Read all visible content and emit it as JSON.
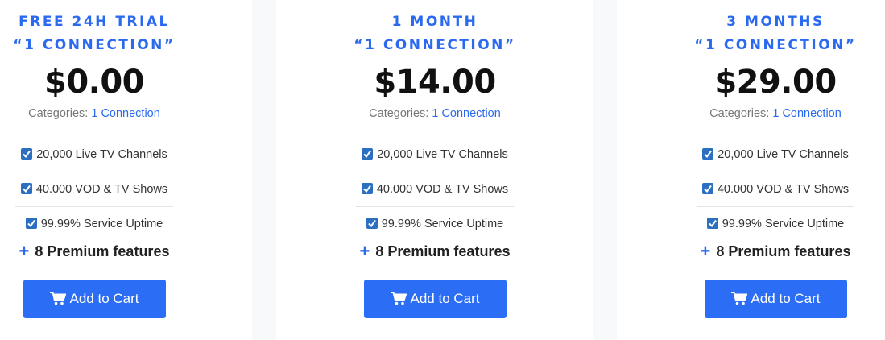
{
  "plans": [
    {
      "title_line1": "FREE 24H TRIAL",
      "title_line2": "“1 CONNECTION”",
      "price": "$0.00",
      "categories_label": "Categories:",
      "categories_link": "1 Connection",
      "features": [
        "20,000 Live TV Channels",
        "40.000 VOD & TV Shows",
        "99.99% Service Uptime"
      ],
      "premium": "8 Premium features",
      "button": "Add to Cart"
    },
    {
      "title_line1": "1 MONTH",
      "title_line2": "“1 CONNECTION”",
      "price": "$14.00",
      "categories_label": "Categories:",
      "categories_link": "1 Connection",
      "features": [
        "20,000 Live TV Channels",
        "40.000 VOD & TV Shows",
        "99.99% Service Uptime"
      ],
      "premium": "8 Premium features",
      "button": "Add to Cart"
    },
    {
      "title_line1": "3 MONTHS",
      "title_line2": "“1 CONNECTION”",
      "price": "$29.00",
      "categories_label": "Categories:",
      "categories_link": "1 Connection",
      "features": [
        "20,000 Live TV Channels",
        "40.000 VOD & TV Shows",
        "99.99% Service Uptime"
      ],
      "premium": "8 Premium features",
      "button": "Add to Cart"
    }
  ],
  "icons": {
    "feature": "checkbox-checked-icon",
    "premium": "plus-icon",
    "button": "shopping-cart-icon"
  },
  "colors": {
    "accent": "#2b6af0",
    "button_bg": "#2b6ef5",
    "checkbox": "#2c6fc0",
    "price": "#111111",
    "gap_bg": "#f8f9fb"
  }
}
